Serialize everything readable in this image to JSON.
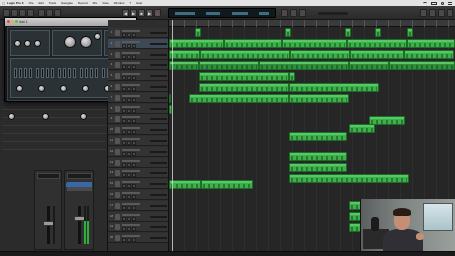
{
  "menubar": {
    "app": "Logic Pro X",
    "items": [
      "File",
      "Edit",
      "Track",
      "Navigate",
      "Record",
      "Mix",
      "View",
      "Window",
      "?",
      "Help"
    ]
  },
  "plugin": {
    "title": "Inst 1"
  },
  "tracks": [
    {
      "num": "1"
    },
    {
      "num": "2"
    },
    {
      "num": "3"
    },
    {
      "num": "4"
    },
    {
      "num": "5"
    },
    {
      "num": "6"
    },
    {
      "num": "7"
    },
    {
      "num": "8"
    },
    {
      "num": "9"
    },
    {
      "num": "10"
    },
    {
      "num": "11"
    },
    {
      "num": "12"
    },
    {
      "num": "13"
    },
    {
      "num": "14"
    },
    {
      "num": "15"
    },
    {
      "num": "16"
    },
    {
      "num": "17"
    },
    {
      "num": "18"
    },
    {
      "num": "19"
    },
    {
      "num": "20"
    }
  ],
  "colors": {
    "region": "#3cb04a",
    "region_border": "#1f6b28",
    "background": "#232323"
  },
  "icons": {
    "apple": "apple-icon",
    "play": "play-icon",
    "stop": "stop-icon",
    "record": "record-icon",
    "rewind": "rewind-icon",
    "forward": "forward-icon"
  }
}
